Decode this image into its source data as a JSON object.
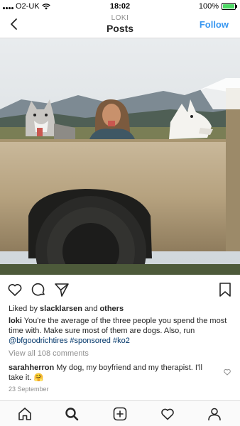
{
  "status_bar": {
    "carrier": "O2-UK",
    "time": "18:02",
    "battery_text": "100%",
    "battery_level": 1.0,
    "battery_color": "#4cd964"
  },
  "header": {
    "subtitle": "LOKI",
    "title": "Posts",
    "follow_label": "Follow",
    "back_icon": "chevron-left-icon",
    "accent_color": "#3897f0"
  },
  "post": {
    "image_icon": "photo",
    "likes": {
      "prefix": "Liked by ",
      "user": "slacklarsen",
      "connector": " and ",
      "others": "others"
    },
    "caption": {
      "username": "loki",
      "text": " You're the average of the three people you spend the most time with. Make sure most of them are dogs. Also, run ",
      "mention": "@bfgoodrichtires",
      "tag1": "#sponsored",
      "tag2": "#ko2"
    },
    "view_all_comments": "View all 108 comments",
    "comment": {
      "username": "sarahherron",
      "text": " My dog, my boyfriend and my therapist. I'll take it. 🤗"
    },
    "date": "23 September"
  },
  "actions": [
    "heart-icon",
    "comment-icon",
    "share-icon",
    "bookmark-icon"
  ],
  "bottom_nav": [
    "home-icon",
    "search-icon",
    "add-post-icon",
    "activity-heart-icon",
    "profile-icon"
  ]
}
